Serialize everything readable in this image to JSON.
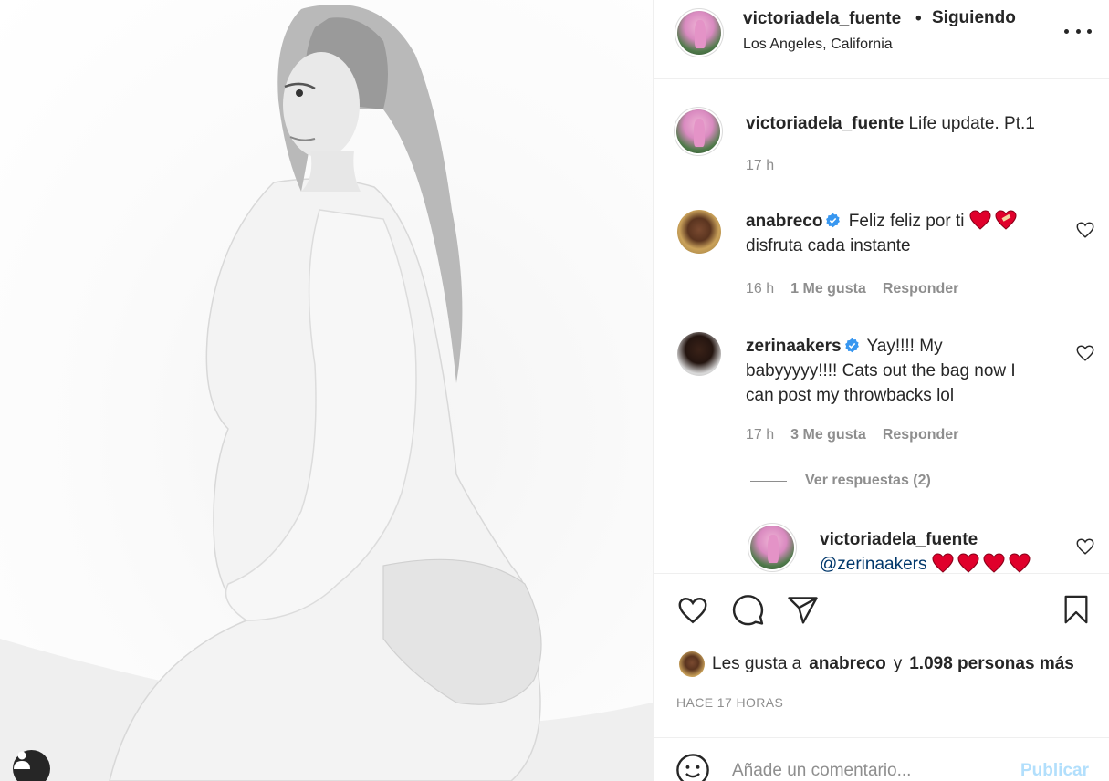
{
  "post": {
    "author": "victoriadela_fuente",
    "separator": "•",
    "follow_status": "Siguiendo",
    "location": "Los Angeles, California",
    "caption_user": "victoriadela_fuente",
    "caption_text": "Life update. Pt.1",
    "caption_time": "17 h"
  },
  "comments": [
    {
      "user": "anabreco",
      "verified": true,
      "text_line1": "Feliz feliz por ti",
      "text_line2": "disfruta cada instante",
      "time": "16 h",
      "likes": "1 Me gusta",
      "reply": "Responder"
    },
    {
      "user": "zerinaakers",
      "verified": true,
      "text_line1": "Yay!!!! My",
      "text_line2": "babyyyyy!!!! Cats out the bag now I",
      "text_line3": "can post my throwbacks lol",
      "time": "17 h",
      "likes": "3 Me gusta",
      "reply": "Responder"
    }
  ],
  "view_replies": "Ver respuestas (2)",
  "reply": {
    "user": "victoriadela_fuente",
    "mention": "@zerinaakers"
  },
  "likes_summary": {
    "prefix": "Les gusta a",
    "user": "anabreco",
    "conj": "y",
    "others": "1.098 personas más"
  },
  "timestamp": "HACE 17 HORAS",
  "composer": {
    "placeholder": "Añade un comentario...",
    "publish": "Publicar"
  },
  "icons": {
    "more": "more-options-icon",
    "like": "heart-icon",
    "comment": "comment-bubble-icon",
    "share": "paper-plane-icon",
    "save": "bookmark-icon",
    "emoji": "emoji-icon",
    "tag": "user-tag-icon",
    "verified": "verified-badge-icon"
  },
  "colors": {
    "text": "#262626",
    "muted": "#8e8e8e",
    "verified": "#3897f0",
    "publish_disabled": "#b2dffc",
    "heart_emoji": "#e0002b",
    "mention": "#00376b"
  }
}
